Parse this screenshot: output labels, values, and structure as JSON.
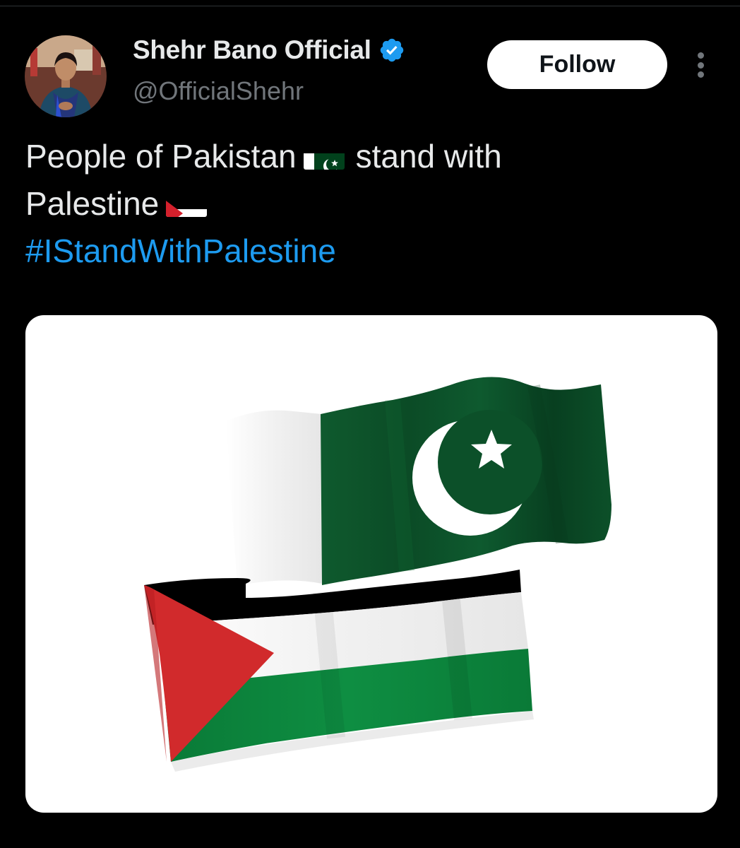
{
  "post": {
    "author": {
      "display_name": "Shehr Bano Official",
      "handle": "@OfficialShehr",
      "verified": true,
      "verified_icon": "verified-badge-icon",
      "avatar_icon": "avatar"
    },
    "follow_label": "Follow",
    "more_icon": "more-options-icon",
    "text": {
      "line1_before": "People of Pakistan",
      "line1_emoji": "pakistan-flag-emoji",
      "line1_after": "stand with",
      "line2_before": "Palestine",
      "line2_emoji": "palestine-flag-emoji",
      "hashtag": "#IStandWithPalestine"
    },
    "media": {
      "image": "pakistan-and-palestine-flags-image"
    }
  },
  "colors": {
    "background": "#000000",
    "text_primary": "#e7e9ea",
    "text_secondary": "#71767b",
    "hashtag": "#1d9bf0",
    "verified": "#1d9bf0",
    "follow_bg": "#ffffff",
    "pakistan_green": "#01411c",
    "palestine_red": "#d4202c",
    "palestine_green": "#0c8a3c"
  }
}
